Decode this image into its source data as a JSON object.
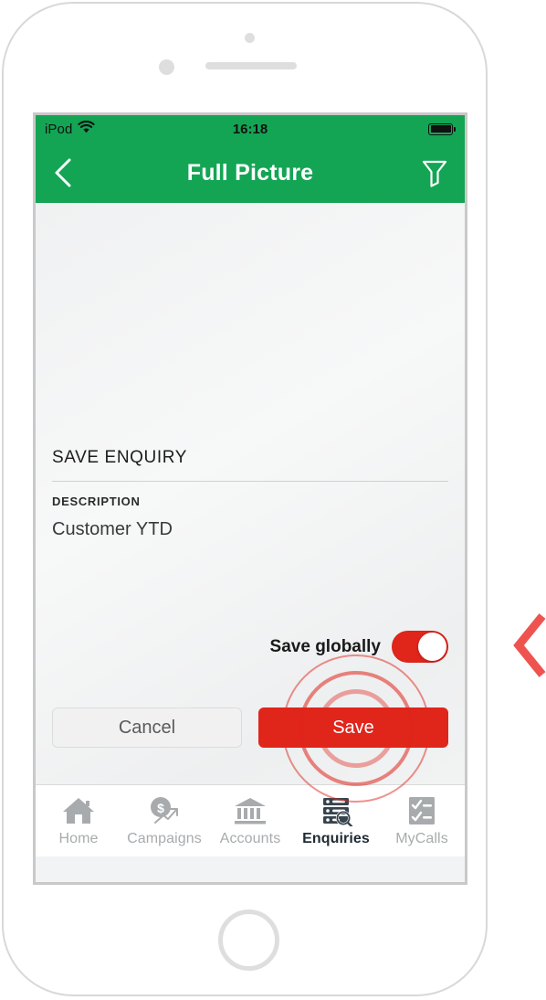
{
  "device": {
    "type": "ipod-touch-mockup",
    "sensor_icon": "proximity-sensor",
    "camera_icon": "front-camera",
    "speaker_icon": "earpiece-speaker",
    "home_button_icon": "home-button"
  },
  "status_bar": {
    "carrier": "iPod",
    "wifi_icon": "wifi-icon",
    "time": "16:18",
    "battery_icon": "battery-full-icon"
  },
  "nav_bar": {
    "back_icon": "chevron-left-icon",
    "title": "Full Picture",
    "filter_icon": "funnel-filter-icon",
    "background_color": "#13a554"
  },
  "form": {
    "section_title": "SAVE ENQUIRY",
    "description_label": "DESCRIPTION",
    "description_value": "Customer YTD"
  },
  "toggle": {
    "label": "Save globally",
    "state": "on",
    "on_color": "#e0251b"
  },
  "buttons": {
    "cancel_label": "Cancel",
    "save_label": "Save",
    "save_color": "#e0251b"
  },
  "tap_indicator": {
    "name": "tap-ripple",
    "target": "save-button",
    "color": "#e0251b"
  },
  "tab_bar": {
    "items": [
      {
        "label": "Home",
        "icon": "home-icon",
        "active": false
      },
      {
        "label": "Campaigns",
        "icon": "campaigns-icon",
        "active": false
      },
      {
        "label": "Accounts",
        "icon": "bank-icon",
        "active": false
      },
      {
        "label": "Enquiries",
        "icon": "server-search-icon",
        "active": true
      },
      {
        "label": "MyCalls",
        "icon": "checklist-icon",
        "active": false
      }
    ]
  },
  "annotation": {
    "pointer_icon": "chevron-left-pointer",
    "pointer_color": "#ef5350"
  }
}
